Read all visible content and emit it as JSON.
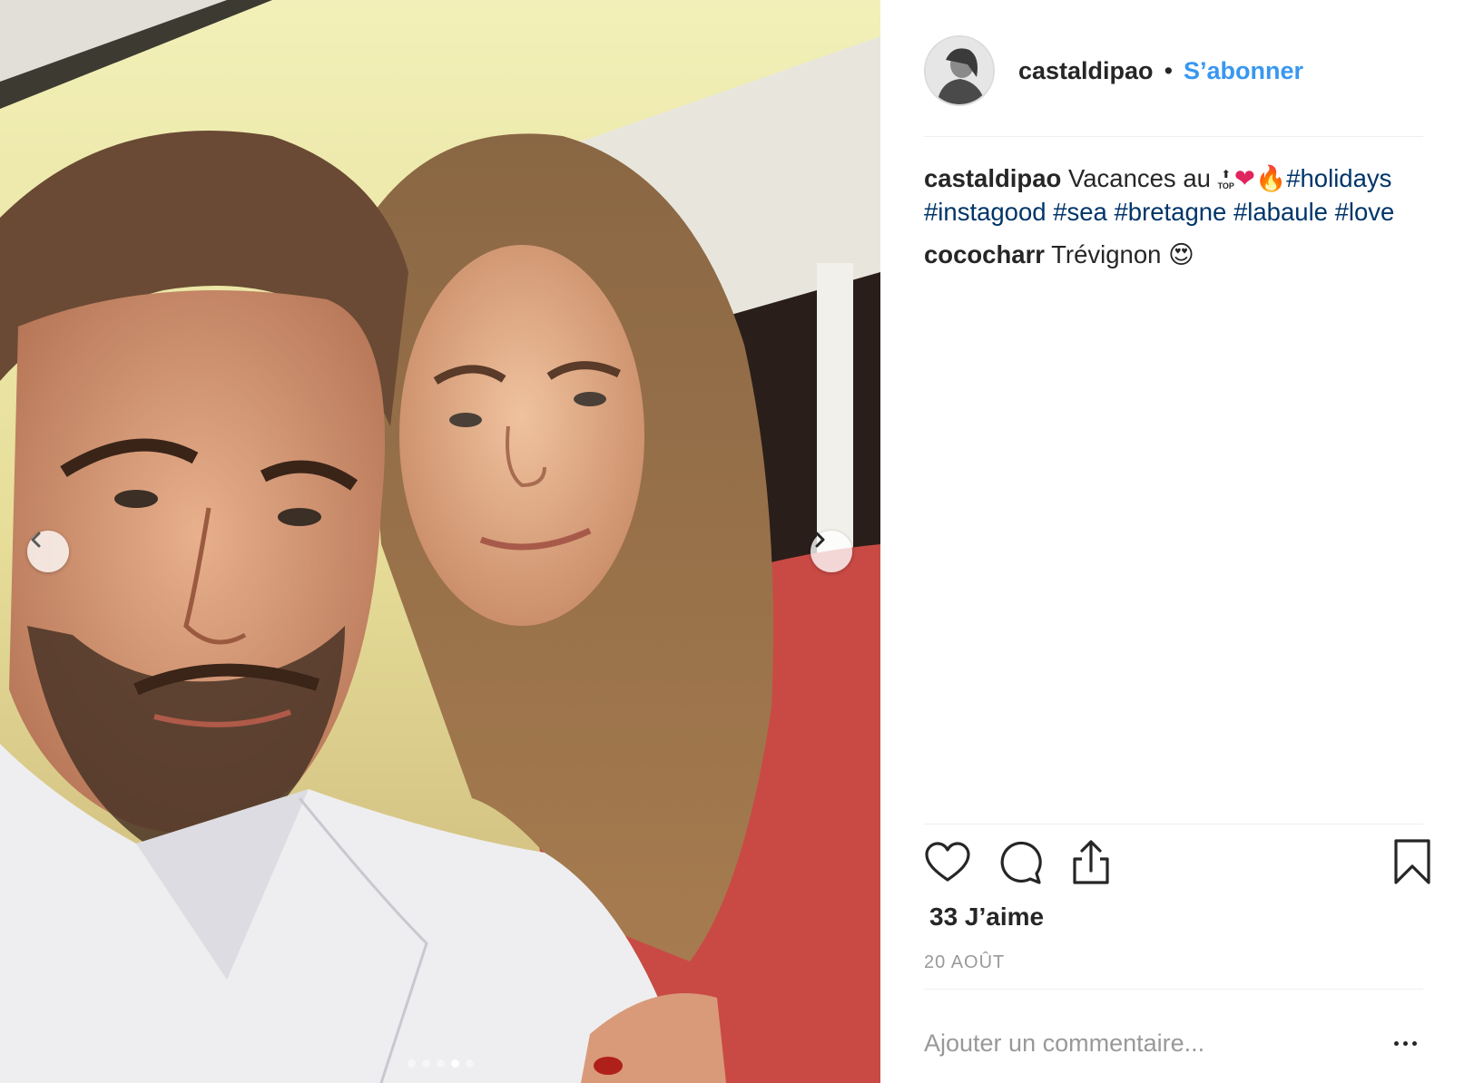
{
  "post": {
    "author": "castaldipao",
    "separator": "•",
    "follow_label": "S’abonner",
    "caption": {
      "user": "castaldipao",
      "text": "Vacances au ",
      "emoji_top": "TOP",
      "emoji_heart": "❤",
      "emoji_fire": "🔥",
      "hashtags": [
        "#holidays",
        "#instagood",
        "#sea",
        "#bretagne",
        "#labaule",
        "#love"
      ]
    },
    "comments": [
      {
        "user": "cococharr",
        "text": "Trévignon",
        "emoji": "😍"
      }
    ],
    "likes_text": "33 J’aime",
    "date_text": "20 AOÛT",
    "comment_placeholder": "Ajouter un commentaire...",
    "carousel": {
      "total_slides": 5,
      "active_slide": 4
    }
  },
  "icons": {
    "like": "heart-icon",
    "comment": "comment-bubble-icon",
    "share": "share-icon",
    "save": "bookmark-icon",
    "more": "more-options-icon",
    "prev": "chevron-left-icon",
    "next": "chevron-right-icon"
  },
  "colors": {
    "follow": "#3897f0",
    "hashtag": "#003569",
    "muted": "#999999",
    "text": "#262626",
    "divider": "#efefef"
  }
}
